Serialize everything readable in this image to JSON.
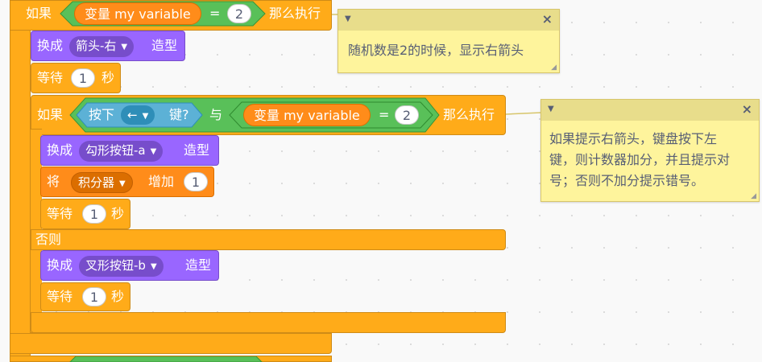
{
  "workspace": {
    "if_block_1": {
      "if_label": "如果",
      "then_label": "那么执行",
      "var_reporter": "变量 my variable",
      "eq_op": "=",
      "compare_value": "2"
    },
    "switch_costume_1": {
      "prefix": "换成",
      "costume": "箭头-右",
      "suffix": "造型"
    },
    "wait_1": {
      "prefix": "等待",
      "value": "1",
      "suffix": "秒"
    },
    "if_else_block": {
      "if_label": "如果",
      "key_prefix": "按下",
      "key_value": "←",
      "key_suffix": "键?",
      "and_label": "与",
      "var_reporter": "变量 my variable",
      "eq_op": "=",
      "compare_value": "2",
      "then_label": "那么执行",
      "else_label": "否则"
    },
    "switch_costume_2": {
      "prefix": "换成",
      "costume": "勾形按钮-a",
      "suffix": "造型"
    },
    "change_var": {
      "prefix": "将",
      "variable": "积分器",
      "middle": "增加",
      "value": "1"
    },
    "wait_2": {
      "prefix": "等待",
      "value": "1",
      "suffix": "秒"
    },
    "switch_costume_3": {
      "prefix": "换成",
      "costume": "叉形按钮-b",
      "suffix": "造型"
    },
    "wait_3": {
      "prefix": "等待",
      "value": "1",
      "suffix": "秒"
    }
  },
  "comments": [
    {
      "text": "随机数是2的时候，显示右箭头"
    },
    {
      "lines": [
        "如果提示右箭头，键盘按下左",
        "键，则计数器加分，并且提示对",
        "号；否则不加分提示错号。"
      ]
    }
  ],
  "icons": {
    "dropdown": "caret-down-icon",
    "close": "close-icon",
    "collapse": "collapse-triangle-icon",
    "resize": "resize-grip-icon"
  },
  "colors": {
    "control": "#ffab19",
    "looks": "#9966ff",
    "variables": "#ff8c1a",
    "operators": "#59c059",
    "sensing": "#5cb1d6",
    "comment": "#fef49c"
  }
}
